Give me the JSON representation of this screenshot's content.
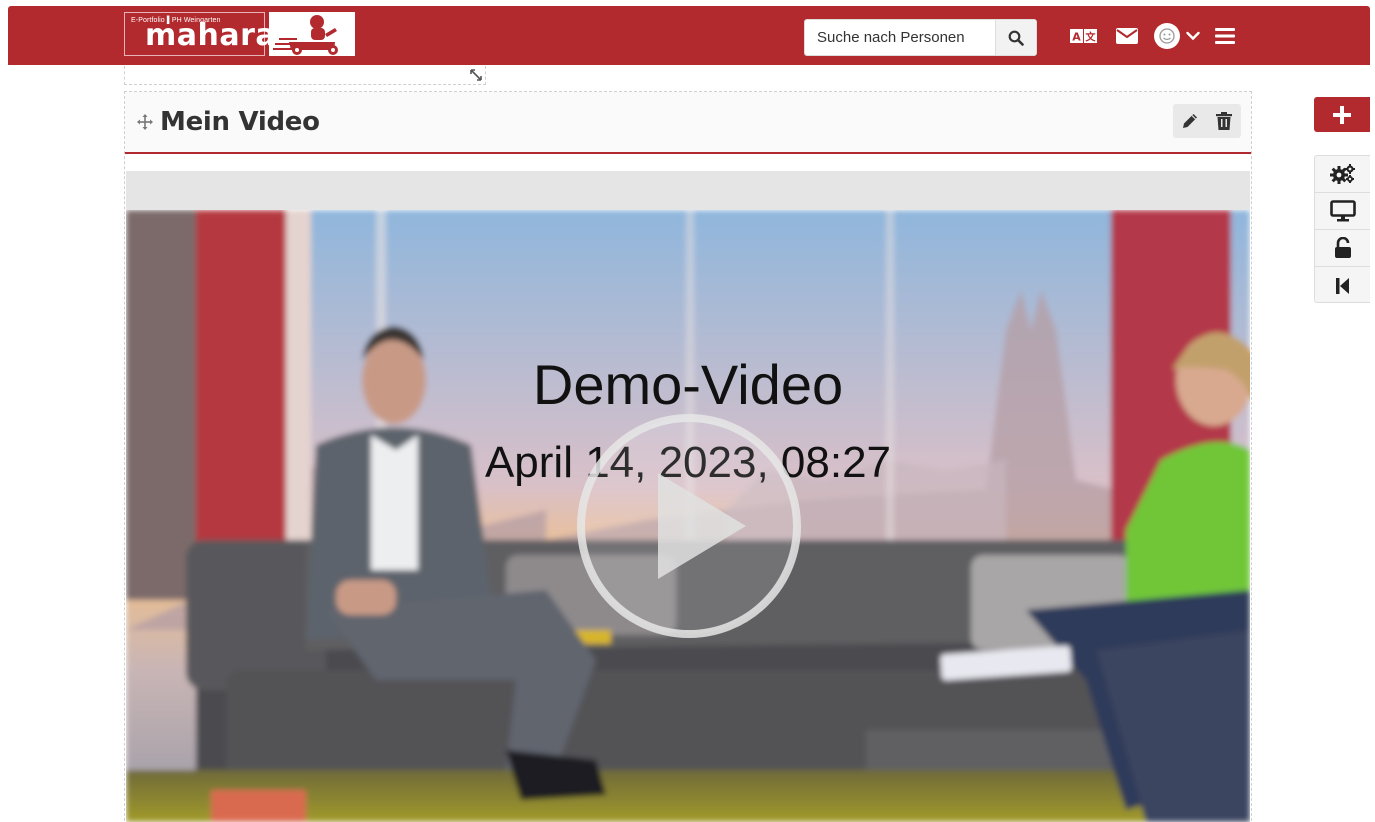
{
  "header": {
    "logo": {
      "small_text": "E-Portfolio ▌PH Weingarten",
      "main_text": "mahara"
    },
    "search": {
      "placeholder": "Suche nach Personen"
    },
    "icons": [
      "search-icon",
      "translate-icon",
      "mail-icon",
      "user-avatar-icon",
      "chevron-down-icon",
      "menu-icon"
    ],
    "brand_color": "#b32a2e"
  },
  "block": {
    "title": "Mein Video",
    "icons": [
      "move-icon",
      "edit-pencil-icon",
      "trash-icon"
    ]
  },
  "video": {
    "title": "Demo-Video",
    "date": "April 14, 2023, 08:27",
    "icons": [
      "play-icon"
    ]
  },
  "sidebar": {
    "icons": [
      "add-icon",
      "settings-gears-icon",
      "display-monitor-icon",
      "unlock-icon",
      "back-to-start-icon"
    ]
  }
}
